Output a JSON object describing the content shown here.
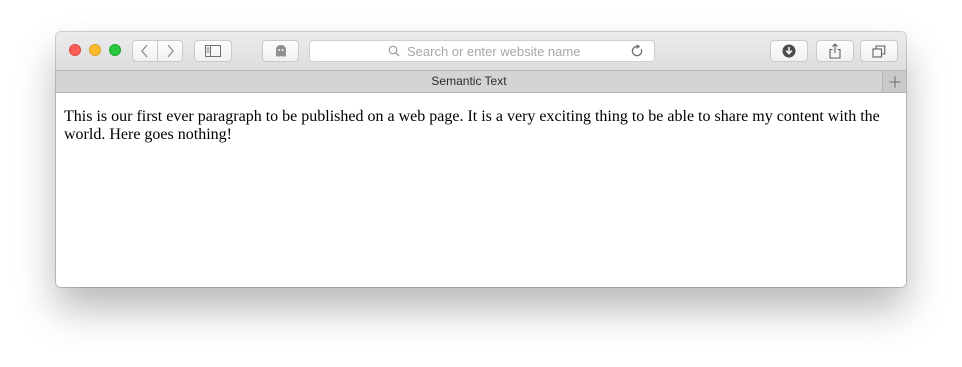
{
  "toolbar": {
    "address_placeholder": "Search or enter website name",
    "icons": {
      "back": "chevron-left-icon",
      "forward": "chevron-right-icon",
      "sidebar": "sidebar-icon",
      "privacy": "ghost-icon",
      "search": "search-icon",
      "reload": "reload-icon",
      "download": "download-icon",
      "share": "share-icon",
      "tabs": "tabs-overview-icon"
    }
  },
  "tabbar": {
    "title": "Semantic Text",
    "new_tab_icon": "plus-icon"
  },
  "page": {
    "paragraph": "This is our first ever paragraph to be published on a web page. It is a very exciting thing to be able to share my content with the world. Here goes nothing!"
  },
  "colors": {
    "close": "#fc5f57",
    "minimize": "#fdbc2e",
    "maximize": "#28c840"
  }
}
